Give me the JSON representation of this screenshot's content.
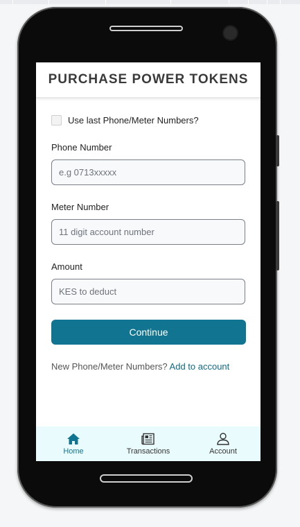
{
  "header": {
    "title": "PURCHASE POWER TOKENS"
  },
  "form": {
    "checkbox_label": "Use last Phone/Meter Numbers?",
    "phone": {
      "label": "Phone Number",
      "placeholder": "e.g 0713xxxxx"
    },
    "meter": {
      "label": "Meter Number",
      "placeholder": "11 digit account number"
    },
    "amount": {
      "label": "Amount",
      "placeholder": "KES to deduct"
    },
    "continue_label": "Continue",
    "note_text": "New Phone/Meter Numbers?",
    "note_link": "Add to account"
  },
  "nav": {
    "items": [
      {
        "label": "Home",
        "icon": "home-icon"
      },
      {
        "label": "Transactions",
        "icon": "newspaper-icon"
      },
      {
        "label": "Account",
        "icon": "user-icon"
      }
    ]
  },
  "colors": {
    "primary": "#117591",
    "nav_bg": "#e9fbfd"
  }
}
